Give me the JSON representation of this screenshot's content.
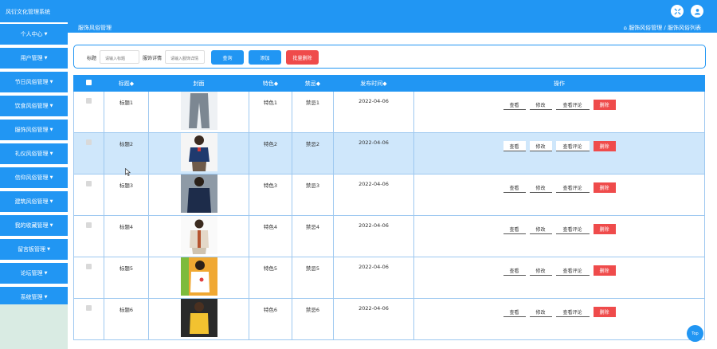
{
  "header": {
    "app_title": "风衍文化管理系统"
  },
  "sidebar": {
    "items": [
      {
        "label": "个人中心"
      },
      {
        "label": "用户管理"
      },
      {
        "label": "节日风俗管理"
      },
      {
        "label": "饮食风俗管理"
      },
      {
        "label": "服饰风俗管理"
      },
      {
        "label": "礼仪风俗管理"
      },
      {
        "label": "信仰风俗管理"
      },
      {
        "label": "建筑风俗管理"
      },
      {
        "label": "我的收藏管理"
      },
      {
        "label": "留言板管理"
      },
      {
        "label": "论坛管理"
      },
      {
        "label": "系统管理"
      }
    ]
  },
  "subheader": {
    "title": "服饰风俗管理",
    "breadcrumb": "服饰风俗管理 / 服饰风俗列表"
  },
  "search": {
    "title_label": "标题",
    "title_placeholder": "请输入标题",
    "detail_label": "服饰详情",
    "detail_placeholder": "请输入服饰详情",
    "query_button": "查询",
    "add_button": "添加",
    "batch_delete_button": "批量删除",
    "query_color": "#2196f3",
    "delete_color": "#ef4b4b"
  },
  "table": {
    "columns": [
      "标题",
      "封面",
      "特色",
      "禁忌",
      "发布时间",
      "操作"
    ],
    "sort_mark": "◆",
    "actions": {
      "view": "查看",
      "edit": "修改",
      "view_comments": "查看评论",
      "delete": "删除"
    },
    "rows": [
      {
        "title": "标题1",
        "feature": "特色1",
        "taboo": "禁忌1",
        "date": "2022-04-06"
      },
      {
        "title": "标题2",
        "feature": "特色2",
        "taboo": "禁忌2",
        "date": "2022-04-06"
      },
      {
        "title": "标题3",
        "feature": "特色3",
        "taboo": "禁忌3",
        "date": "2022-04-06"
      },
      {
        "title": "标题4",
        "feature": "特色4",
        "taboo": "禁忌4",
        "date": "2022-04-06"
      },
      {
        "title": "标题5",
        "feature": "特色5",
        "taboo": "禁忌5",
        "date": "2022-04-06"
      },
      {
        "title": "标题6",
        "feature": "特色6",
        "taboo": "禁忌6",
        "date": "2022-04-06"
      }
    ]
  },
  "back_to_top": "Top"
}
